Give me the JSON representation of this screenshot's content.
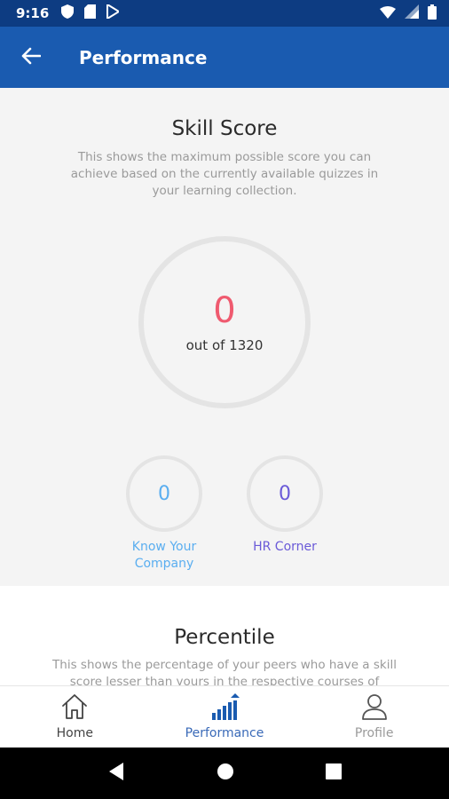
{
  "status_bar": {
    "time": "9:16"
  },
  "app_bar": {
    "title": "Performance"
  },
  "skill_score": {
    "title": "Skill Score",
    "description": "This shows the maximum possible score you can achieve based on the currently available quizzes in your learning collection.",
    "value": "0",
    "out_of": "out of 1320",
    "score_color": "#ef5a6f"
  },
  "categories": [
    {
      "value": "0",
      "label": "Know Your Company",
      "color": "#5aaef0"
    },
    {
      "value": "0",
      "label": "HR Corner",
      "color": "#6a5ad8"
    }
  ],
  "percentile": {
    "title": "Percentile",
    "description": "This shows the percentage of your peers who have a skill score lesser than yours in the respective courses of"
  },
  "bottom_nav": [
    {
      "label": "Home",
      "icon": "home-icon"
    },
    {
      "label": "Performance",
      "icon": "performance-icon",
      "active": true
    },
    {
      "label": "Profile",
      "icon": "profile-icon"
    }
  ],
  "colors": {
    "status_bar": "#0d3c82",
    "app_bar": "#1a5bb0",
    "accent": "#3a6ab8"
  }
}
